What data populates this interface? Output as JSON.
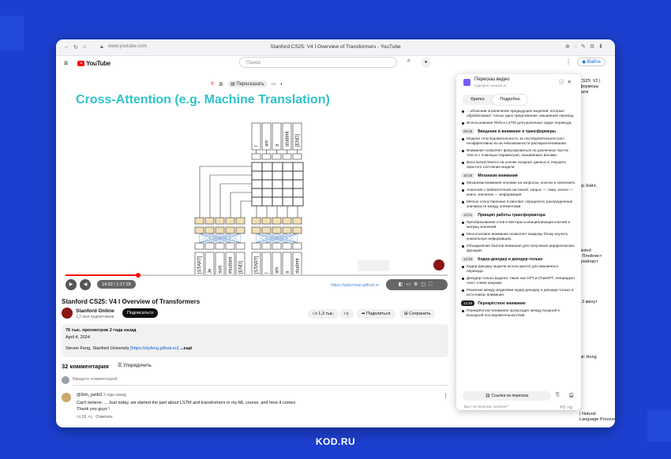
{
  "browser": {
    "url": "www.youtube.com",
    "tab_title": "Stanford CS25: V4 I Overview of Transformers - YouTube"
  },
  "youtube": {
    "logo_text": "YouTube",
    "search_placeholder": "Поиск",
    "login_label": "Войти",
    "icons": [
      "menu-icon",
      "youtube-logo",
      "search-icon",
      "microphone-icon",
      "more-vert-icon",
      "account-icon"
    ]
  },
  "player": {
    "slide_title": "Cross-Attention (e.g. Machine Translation)",
    "ya_retell_label": "Пересказать",
    "time": "14:52 / 1:17:29",
    "link_text": "https://jalammar.github.io",
    "progress": 0.19,
    "progress_color": "#ff0000",
    "decoder_tokens": [
      "I",
      "am",
      "a",
      "student",
      "[END]"
    ],
    "encoder_tokens_left": [
      "[START]",
      "Je",
      "suis",
      "étudiant",
      "[END]"
    ],
    "encoder_tokens_right": [
      "[START]",
      "I",
      "am",
      "a",
      "student"
    ]
  },
  "video": {
    "title": "Stanford CS25: V4 I Overview of Transformers",
    "channel": "Stanford Online",
    "subscribers": "1,2 млн подписчиков",
    "subscribe_label": "Подписаться",
    "likes": "1,3 тыс.",
    "share_label": "Поделиться",
    "save_label": "Сохранить"
  },
  "description": {
    "stats": "76 тыс. просмотров  2 года назад",
    "date": "April 4, 2024",
    "text": "Steven Feng, Stanford University",
    "link": "[https://styfeng.github.io/]",
    "more": "...ещё"
  },
  "comments": {
    "count_label": "32 комментария",
    "sort_label": "Упорядочить",
    "add_placeholder": "Введите комментарий",
    "items": [
      {
        "user": "@Slim_yanfs3",
        "time": "3 года назад",
        "text_line1": "Can't believe, ... Just today, we started the part about LSTM and transformers in my ML course, and here it comes",
        "text_line2": "Thank you guys !",
        "likes": "15",
        "reply_label": "Ответить"
      }
    ]
  },
  "sidebar": {
    "snippets": [
      {
        "text": "CS25: V2 |\nформеры\nпати"
      },
      {
        "text": "ер Хойл,\nк"
      },
      {
        "text": "nisted\n• Плейлист\nплейлист"
      },
      {
        "text": "13 минут"
      },
      {
        "text": "ial: Hong"
      },
      {
        "text": "| Natural\nLanguage Processing with"
      }
    ]
  },
  "retell_panel": {
    "title": "Пересказ видео",
    "subtitle": "Сделано Алисой AI",
    "tabs": [
      "Кратко",
      "Подробно"
    ],
    "active_tab": 1,
    "sections": [
      {
        "time": "",
        "title": "",
        "bullets": [
          "…объяснив ограничение предыдущих моделей, которые обрабатывают только одно предложение, машинный перевод.",
          "Использование RNN и LSTM для различных задач перевода."
        ]
      },
      {
        "time": "09:28",
        "title": "Введение в внимание и трансформеры",
        "bullets": [
          "Модели «последовательность за последовательностью» неэффективны из-за невозможности распараллеливания.",
          "Внимание позволяет фокусироваться на различных частях текста с помощью параметров, называемых весами.",
          "Веса вычисляются на основе входных данных и текущего скрытого состояния модели."
        ]
      },
      {
        "time": "10:25",
        "title": "Механизм внимания",
        "bullets": [
          "Механизм внимания основан на запросах, ключах и значениях.",
          "Аналогия с библиотечной системой: запрос — тема, ключи — книги, значения — информация.",
          "Мягкое сопоставление позволяет определить распределение значимости между элементами."
        ]
      },
      {
        "time": "12:01",
        "title": "Принцип работы трансформатора",
        "bullets": [
          "Преобразование слов в векторы и инициализация ключей и матриц значений.",
          "Многоголовое внимание позволяет каждому блоку изучать уникальную информацию.",
          "Объединение баллов внимания для получения иерархических функций."
        ]
      },
      {
        "time": "12:53",
        "title": "Кодер-декодер и декодер-только",
        "bullets": [
          "Кодер-декодер модели используются для машинного перевода.",
          "Декодер-только модели, такие как GPT и ChatGPT, генерируют текст слева направо.",
          "Различие между моделями кодер-декодер и декодер-только в источниках внимания."
        ]
      },
      {
        "time": "14:40",
        "title": "Перекрёстное внимание",
        "dark": true,
        "bullets": [
          "Перекрёстное внимание происходит между входной и выходной последовательностями."
        ]
      }
    ],
    "link_button": "Ссылка на пересказ",
    "feedback_question": "Был ли пересказ полезен?"
  },
  "footer": {
    "brand": "KOD.RU"
  },
  "colors": {
    "page_bg": "#1c3fcf",
    "slide_title": "#2fc3c9",
    "yt_red": "#ff0000",
    "panel_accent": "#7b5cff"
  }
}
